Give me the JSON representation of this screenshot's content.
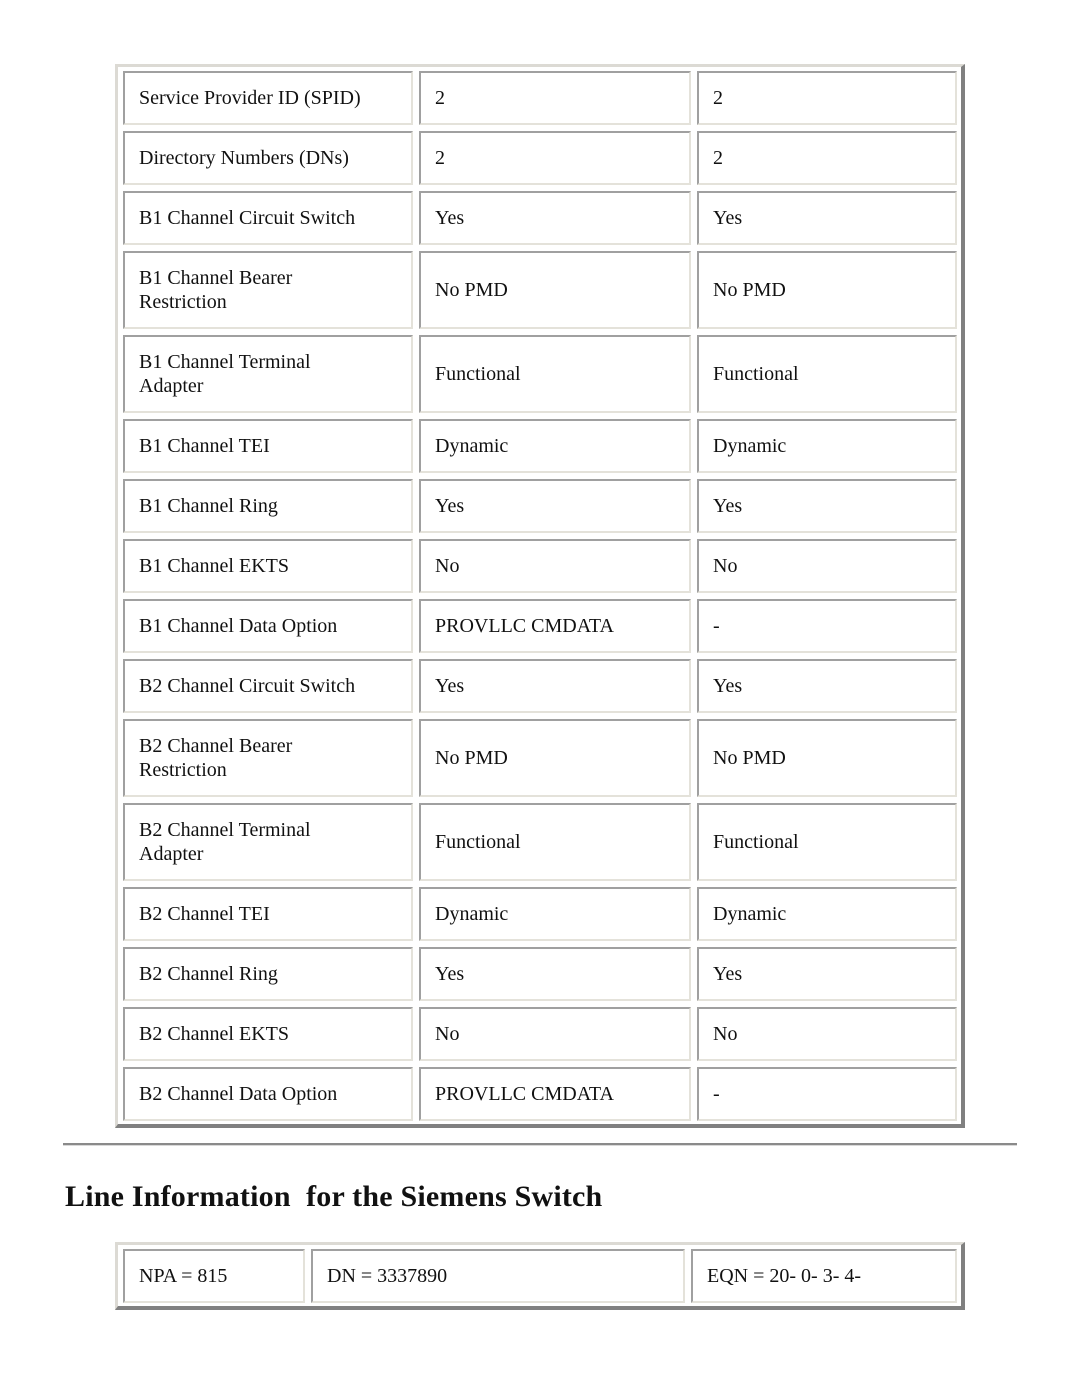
{
  "config_table": {
    "rows": [
      {
        "label": "Service Provider ID (SPID)",
        "v1": "2",
        "v2": "2"
      },
      {
        "label": "Directory Numbers (DNs)",
        "v1": "2",
        "v2": "2"
      },
      {
        "label": "B1 Channel Circuit Switch",
        "v1": "Yes",
        "v2": "Yes"
      },
      {
        "label": "B1 Channel Bearer Restriction",
        "v1": "No PMD",
        "v2": "No PMD"
      },
      {
        "label": "B1 Channel Terminal Adapter",
        "v1": "Functional",
        "v2": "Functional"
      },
      {
        "label": "B1 Channel TEI",
        "v1": "Dynamic",
        "v2": "Dynamic"
      },
      {
        "label": "B1 Channel Ring",
        "v1": "Yes",
        "v2": "Yes"
      },
      {
        "label": "B1 Channel EKTS",
        "v1": "No",
        "v2": "No"
      },
      {
        "label": "B1 Channel Data Option",
        "v1": "PROVLLC CMDATA",
        "v2": "-"
      },
      {
        "label": "B2 Channel Circuit Switch",
        "v1": "Yes",
        "v2": "Yes"
      },
      {
        "label": "B2 Channel Bearer Restriction",
        "v1": "No PMD",
        "v2": "No PMD"
      },
      {
        "label": "B2 Channel Terminal Adapter",
        "v1": "Functional",
        "v2": "Functional"
      },
      {
        "label": "B2 Channel TEI",
        "v1": "Dynamic",
        "v2": "Dynamic"
      },
      {
        "label": "B2 Channel Ring",
        "v1": "Yes",
        "v2": "Yes"
      },
      {
        "label": "B2 Channel EKTS",
        "v1": "No",
        "v2": "No"
      },
      {
        "label": "B2 Channel Data Option",
        "v1": "PROVLLC CMDATA",
        "v2": "-"
      }
    ]
  },
  "section_heading": "Line Information  for the Siemens Switch",
  "line_table": {
    "npa": "NPA = 815",
    "dn": "DN = 3337890",
    "eqn": "EQN = 20- 0- 3- 4-"
  }
}
